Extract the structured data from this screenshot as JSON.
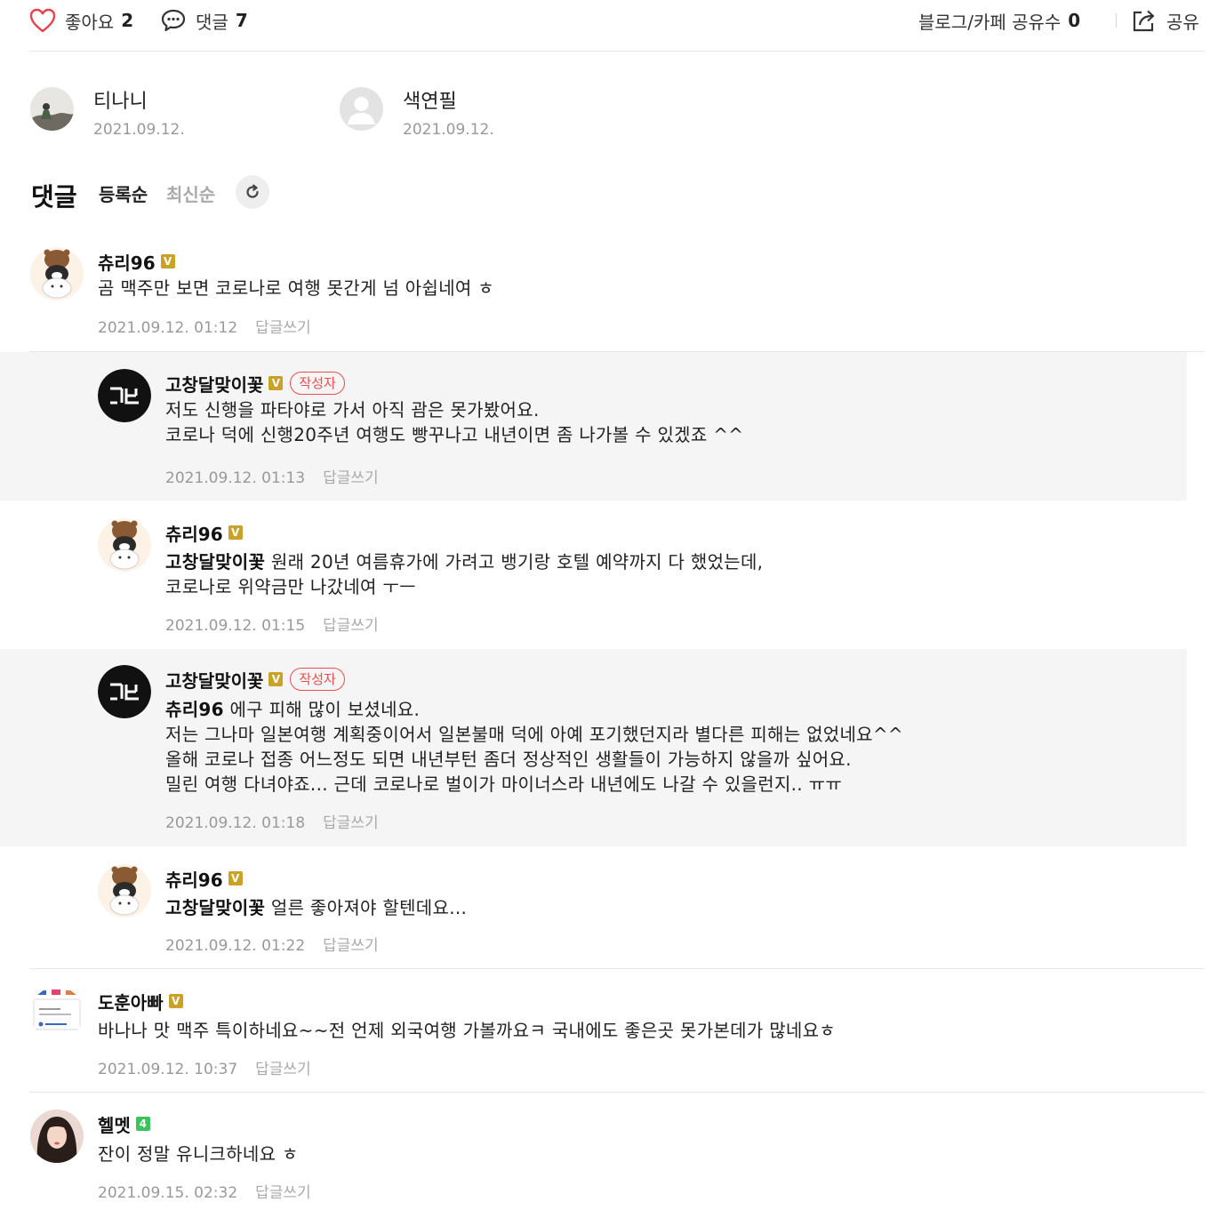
{
  "actions": {
    "like_label": "좋아요",
    "like_count": "2",
    "comment_label": "댓글",
    "comment_count": "7",
    "share_count_label": "블로그/카페 공유수",
    "share_count": "0",
    "share_label": "공유"
  },
  "likers": [
    {
      "name": "티나니",
      "date": "2021.09.12."
    },
    {
      "name": "색연필",
      "date": "2021.09.12."
    }
  ],
  "comments_header": {
    "title": "댓글",
    "sort_registered": "등록순",
    "sort_latest": "최신순"
  },
  "reply_label": "답글쓰기",
  "author_badge": "작성자",
  "badge_v": "V",
  "badge_4": "4",
  "comments": [
    {
      "nick": "츄리96",
      "lines": [
        "곰 맥주만 보면 코로나로 여행 못간게 넘 아쉽네여 ㅎ"
      ],
      "time": "2021.09.12. 01:12"
    },
    {
      "nick": "고창달맞이꽃",
      "lines": [
        "저도 신행을 파타야로 가서 아직 괌은 못가봤어요.",
        "코로나 덕에 신행20주년 여행도 빵꾸나고 내년이면 좀 나가볼 수 있겠죠 ^^"
      ],
      "time": "2021.09.12. 01:13"
    },
    {
      "nick": "츄리96",
      "mention": "고창달맞이꽃",
      "lines": [
        "원래 20년 여름휴가에 가려고 뱅기랑 호텔 예약까지 다 했었는데,",
        "코로나로 위약금만 나갔네여 ㅜㅡ"
      ],
      "time": "2021.09.12. 01:15"
    },
    {
      "nick": "고창달맞이꽃",
      "mention": "츄리96",
      "lines": [
        "에구 피해 많이 보셨네요.",
        "저는 그나마 일본여행 계획중이어서 일본불매 덕에 아예 포기했던지라 별다른 피해는 없었네요^^",
        "올해 코로나 접종 어느정도 되면 내년부턴 좀더 정상적인 생활들이 가능하지 않을까 싶어요.",
        "밀린 여행 다녀야죠... 근데 코로나로 벌이가 마이너스라 내년에도 나갈 수 있을런지.. ㅠㅠ"
      ],
      "time": "2021.09.12. 01:18"
    },
    {
      "nick": "츄리96",
      "mention": "고창달맞이꽃",
      "lines": [
        "얼른 좋아져야 할텐데요..."
      ],
      "time": "2021.09.12. 01:22"
    },
    {
      "nick": "도훈아빠",
      "lines": [
        "바나나 맛 맥주 특이하네요~~전 언제 외국여행 가볼까요ㅋ 국내에도 좋은곳 못가본데가 많네요ㅎ"
      ],
      "time": "2021.09.12. 10:37"
    },
    {
      "nick": "헬멧",
      "lines": [
        "잔이 정말 유니크하네요 ㅎ"
      ],
      "time": "2021.09.15. 02:32"
    }
  ]
}
